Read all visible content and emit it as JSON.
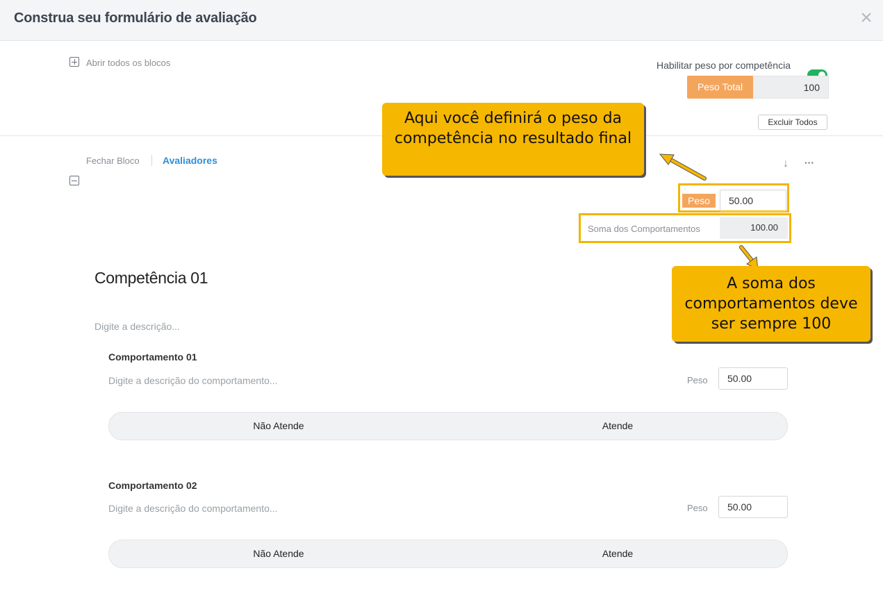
{
  "header": {
    "title": "Construa seu formulário de avaliação",
    "close_label": "×"
  },
  "toolbar": {
    "open_all_label": "Abrir todos os blocos",
    "enable_weight_label": "Habilitar peso por competência",
    "enable_weight_on": true,
    "peso_total_label": "Peso Total",
    "peso_total_value": "100",
    "delete_all_label": "Excluir Todos"
  },
  "block": {
    "close_label": "Fechar Bloco",
    "evaluators_label": "Avaliadores",
    "move_down_icon": "↓",
    "more_icon": "···",
    "peso_label": "Peso",
    "peso_value": "50.00",
    "soma_label": "Soma dos Comportamentos",
    "soma_value": "100.00"
  },
  "callouts": {
    "weight": "Aqui você definirá o peso da competência no resultado final",
    "sum": "A soma dos comportamentos deve ser sempre 100"
  },
  "competency": {
    "title": "Competência 01",
    "description_placeholder": "Digite a descrição...",
    "behaviors": [
      {
        "title": "Comportamento 01",
        "description_placeholder": "Digite a descrição do comportamento...",
        "peso_label": "Peso",
        "peso_value": "50.00",
        "scale": [
          "Não Atende",
          "Atende"
        ]
      },
      {
        "title": "Comportamento 02",
        "description_placeholder": "Digite a descrição do comportamento...",
        "peso_label": "Peso",
        "peso_value": "50.00",
        "scale": [
          "Não Atende",
          "Atende"
        ]
      }
    ]
  },
  "colors": {
    "accent_orange": "#f4a55c",
    "toggle_green": "#21b25f",
    "callout_yellow": "#f6b700",
    "link_blue": "#2f8fd8"
  }
}
